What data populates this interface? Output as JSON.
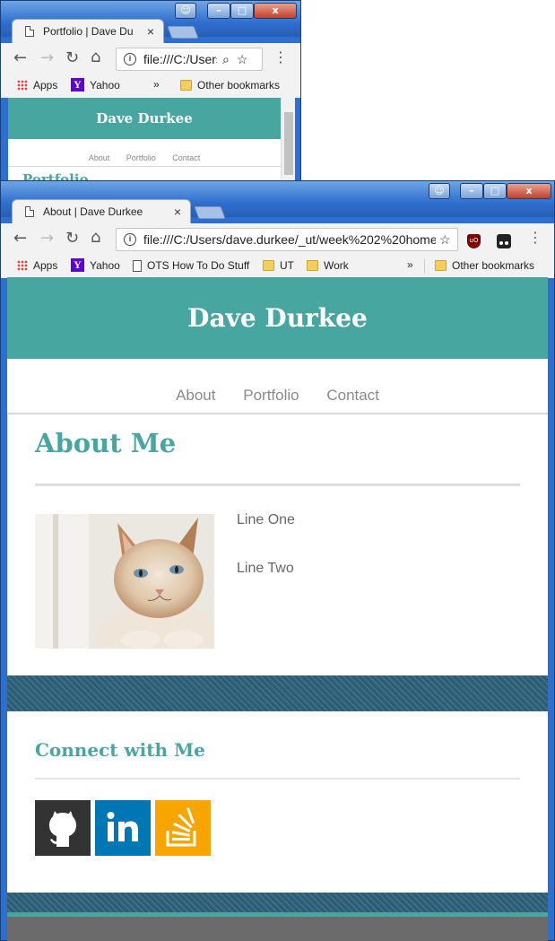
{
  "back_window": {
    "tab_title": "Portfolio | Dave Du",
    "url": "file:///C:/Users",
    "bookmarks": {
      "apps": "Apps",
      "yahoo": "Yahoo",
      "more": "»",
      "other": "Other bookmarks"
    },
    "site_title": "Dave Durkee",
    "nav": [
      "About",
      "Portfolio",
      "Contact"
    ],
    "partial_heading": "Portfolio"
  },
  "front_window": {
    "tab_title": "About | Dave Durkee",
    "url": "file:///C:/Users/dave.durkee/_ut/week%202%20home",
    "bookmarks": {
      "apps": "Apps",
      "yahoo": "Yahoo",
      "ots": "OTS How To Do Stuff",
      "ut": "UT",
      "work": "Work",
      "more": "»",
      "other": "Other bookmarks"
    },
    "window_controls": {
      "minimize": "–",
      "maximize": "□",
      "close": "x"
    }
  },
  "page": {
    "site_title": "Dave Durkee",
    "nav": {
      "about": "About",
      "portfolio": "Portfolio",
      "contact": "Contact"
    },
    "about_heading": "About Me",
    "lines": [
      "Line One",
      "Line Two"
    ],
    "connect_heading": "Connect with Me",
    "social": [
      {
        "name": "GitHub",
        "icon": "github-icon",
        "color": "#333333"
      },
      {
        "name": "LinkedIn",
        "icon": "linkedin-icon",
        "color": "#0077b5"
      },
      {
        "name": "Stack Overflow",
        "icon": "stackoverflow-icon",
        "color": "#f9a500"
      }
    ]
  },
  "colors": {
    "accent": "#48a6a1",
    "denim": "#2f5f78",
    "footer": "#6b6b6b"
  }
}
